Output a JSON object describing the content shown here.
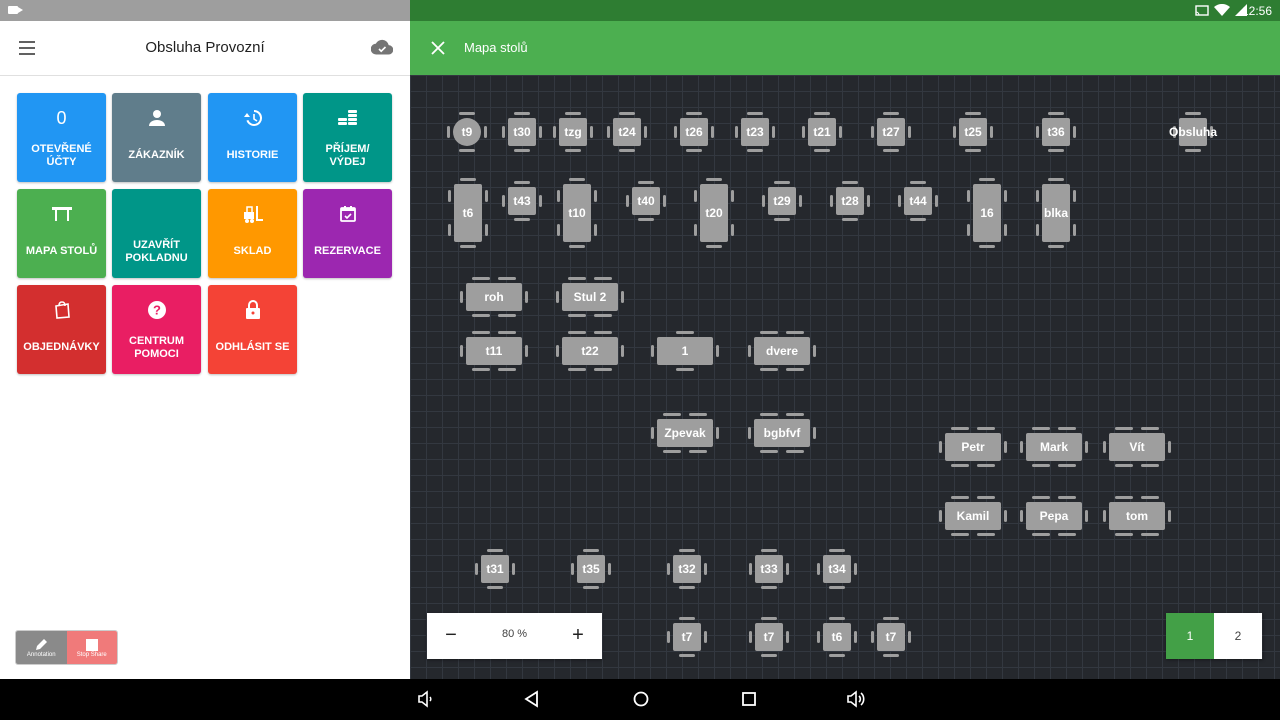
{
  "left": {
    "title": "Obsluha Provozní",
    "tiles": [
      {
        "label": "0",
        "sub": "Otevřené účty",
        "color": "#2196f3",
        "icon": "counter"
      },
      {
        "label": "",
        "sub": "Zákazník",
        "color": "#607d8b",
        "icon": "person-icon"
      },
      {
        "label": "",
        "sub": "Historie",
        "color": "#2196f3",
        "icon": "history-icon"
      },
      {
        "label": "",
        "sub": "Příjem/ výdej",
        "color": "#009688",
        "icon": "coins-icon"
      },
      {
        "label": "",
        "sub": "Mapa stolů",
        "color": "#4caf50",
        "icon": "table-icon"
      },
      {
        "label": "",
        "sub": "Uzavřít pokladnu",
        "color": "#009688",
        "icon": "none"
      },
      {
        "label": "",
        "sub": "Sklad",
        "color": "#ff9800",
        "icon": "forklift-icon"
      },
      {
        "label": "",
        "sub": "Rezervace",
        "color": "#9c27b0",
        "icon": "calendar-icon"
      },
      {
        "label": "",
        "sub": "Objednávky",
        "color": "#d32f2f",
        "icon": "bag-icon"
      },
      {
        "label": "",
        "sub": "Centrum pomoci",
        "color": "#e91e63",
        "icon": "help-icon"
      },
      {
        "label": "",
        "sub": "Odhlásit se",
        "color": "#f44336",
        "icon": "lock-icon"
      }
    ],
    "annotation": {
      "annotation_label": "Annotation",
      "stop_label": "Stop Share"
    }
  },
  "right": {
    "clock": "12:56",
    "title": "Mapa stolů",
    "zoom": "80 %",
    "pages": [
      "1",
      "2"
    ],
    "active_page": "1",
    "tables": [
      {
        "name": "t9",
        "kind": "round"
      },
      {
        "name": "t30",
        "kind": "square4"
      },
      {
        "name": "tzg",
        "kind": "square4"
      },
      {
        "name": "t24",
        "kind": "square4"
      },
      {
        "name": "t26",
        "kind": "square4"
      },
      {
        "name": "t23",
        "kind": "square4"
      },
      {
        "name": "t21",
        "kind": "square4"
      },
      {
        "name": "t27",
        "kind": "square4"
      },
      {
        "name": "t25",
        "kind": "square4"
      },
      {
        "name": "t36",
        "kind": "square4"
      },
      {
        "name": "Obsluha",
        "kind": "square4"
      },
      {
        "name": "t6",
        "kind": "tall6"
      },
      {
        "name": "t43",
        "kind": "square4"
      },
      {
        "name": "t10",
        "kind": "tall6"
      },
      {
        "name": "t40",
        "kind": "square4"
      },
      {
        "name": "t20",
        "kind": "tall6"
      },
      {
        "name": "t29",
        "kind": "square4"
      },
      {
        "name": "t28",
        "kind": "square4"
      },
      {
        "name": "t44",
        "kind": "square4"
      },
      {
        "name": "16",
        "kind": "tall6"
      },
      {
        "name": "blka",
        "kind": "tall6"
      },
      {
        "name": "roh",
        "kind": "wide6"
      },
      {
        "name": "Stul 2",
        "kind": "wide6"
      },
      {
        "name": "t11",
        "kind": "wide6"
      },
      {
        "name": "t22",
        "kind": "wide6"
      },
      {
        "name": "1",
        "kind": "wide4"
      },
      {
        "name": "dvere",
        "kind": "wide6"
      },
      {
        "name": "Zpevak",
        "kind": "wide6"
      },
      {
        "name": "bgbfvf",
        "kind": "wide6"
      },
      {
        "name": "Petr",
        "kind": "wide6"
      },
      {
        "name": "Mark",
        "kind": "wide6"
      },
      {
        "name": "Vít",
        "kind": "wide6"
      },
      {
        "name": "Kamil",
        "kind": "wide6"
      },
      {
        "name": "Pepa",
        "kind": "wide6"
      },
      {
        "name": "tom",
        "kind": "wide6"
      },
      {
        "name": "t31",
        "kind": "square4"
      },
      {
        "name": "t35",
        "kind": "square4"
      },
      {
        "name": "t32",
        "kind": "square4"
      },
      {
        "name": "t33",
        "kind": "square4"
      },
      {
        "name": "t34",
        "kind": "square4"
      },
      {
        "name": "t7",
        "kind": "square4"
      },
      {
        "name": "t7",
        "kind": "square4"
      },
      {
        "name": "t6",
        "kind": "square4"
      },
      {
        "name": "t7",
        "kind": "square4"
      }
    ]
  },
  "colors": {
    "accent": "#4caf50",
    "status_bar": "#2e7d32",
    "map_bg": "#25282d",
    "table": "#9e9e9e"
  }
}
